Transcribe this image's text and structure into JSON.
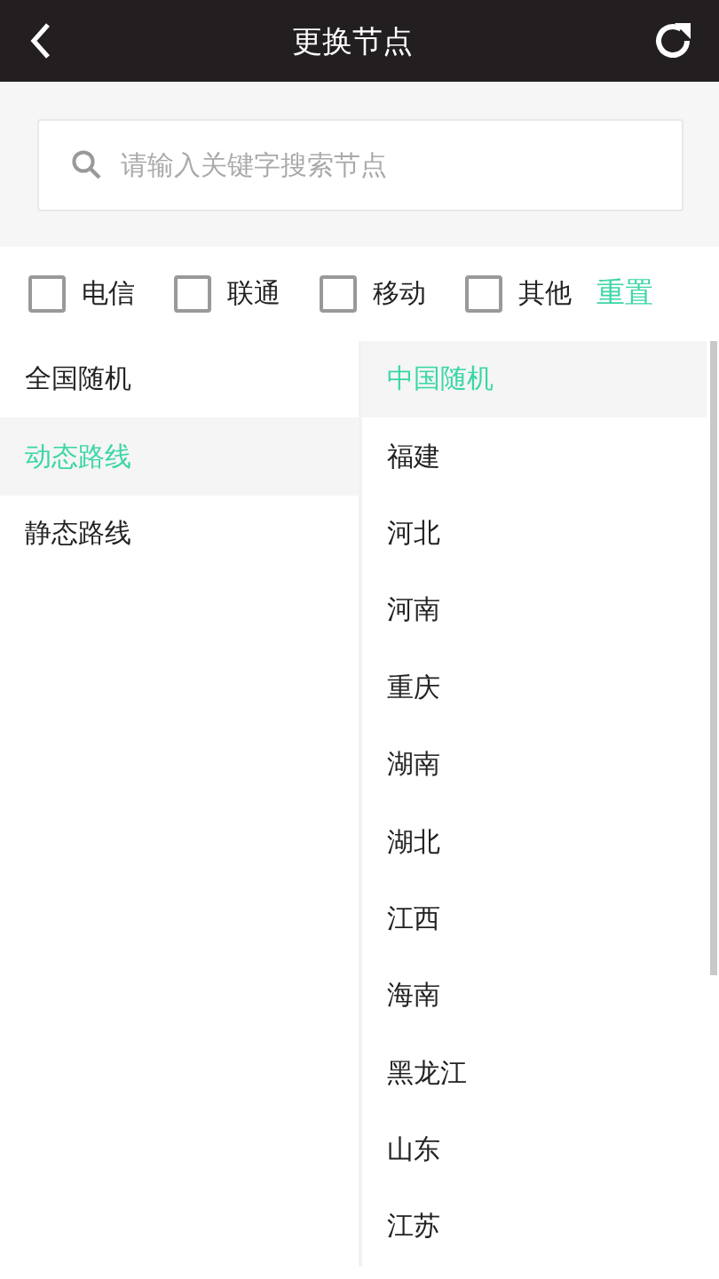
{
  "header": {
    "title": "更换节点"
  },
  "search": {
    "placeholder": "请输入关键字搜索节点"
  },
  "filters": [
    {
      "label": "电信",
      "checked": false
    },
    {
      "label": "联通",
      "checked": false
    },
    {
      "label": "移动",
      "checked": false
    },
    {
      "label": "其他",
      "checked": false
    }
  ],
  "reset_label": "重置",
  "categories": [
    {
      "label": "全国随机",
      "selected": false
    },
    {
      "label": "动态路线",
      "selected": true
    },
    {
      "label": "静态路线",
      "selected": false
    }
  ],
  "nodes": [
    {
      "label": "中国随机",
      "selected": true
    },
    {
      "label": "福建",
      "selected": false
    },
    {
      "label": "河北",
      "selected": false
    },
    {
      "label": "河南",
      "selected": false
    },
    {
      "label": "重庆",
      "selected": false
    },
    {
      "label": "湖南",
      "selected": false
    },
    {
      "label": "湖北",
      "selected": false
    },
    {
      "label": "江西",
      "selected": false
    },
    {
      "label": "海南",
      "selected": false
    },
    {
      "label": "黑龙江",
      "selected": false
    },
    {
      "label": "山东",
      "selected": false
    },
    {
      "label": "江苏",
      "selected": false
    }
  ]
}
